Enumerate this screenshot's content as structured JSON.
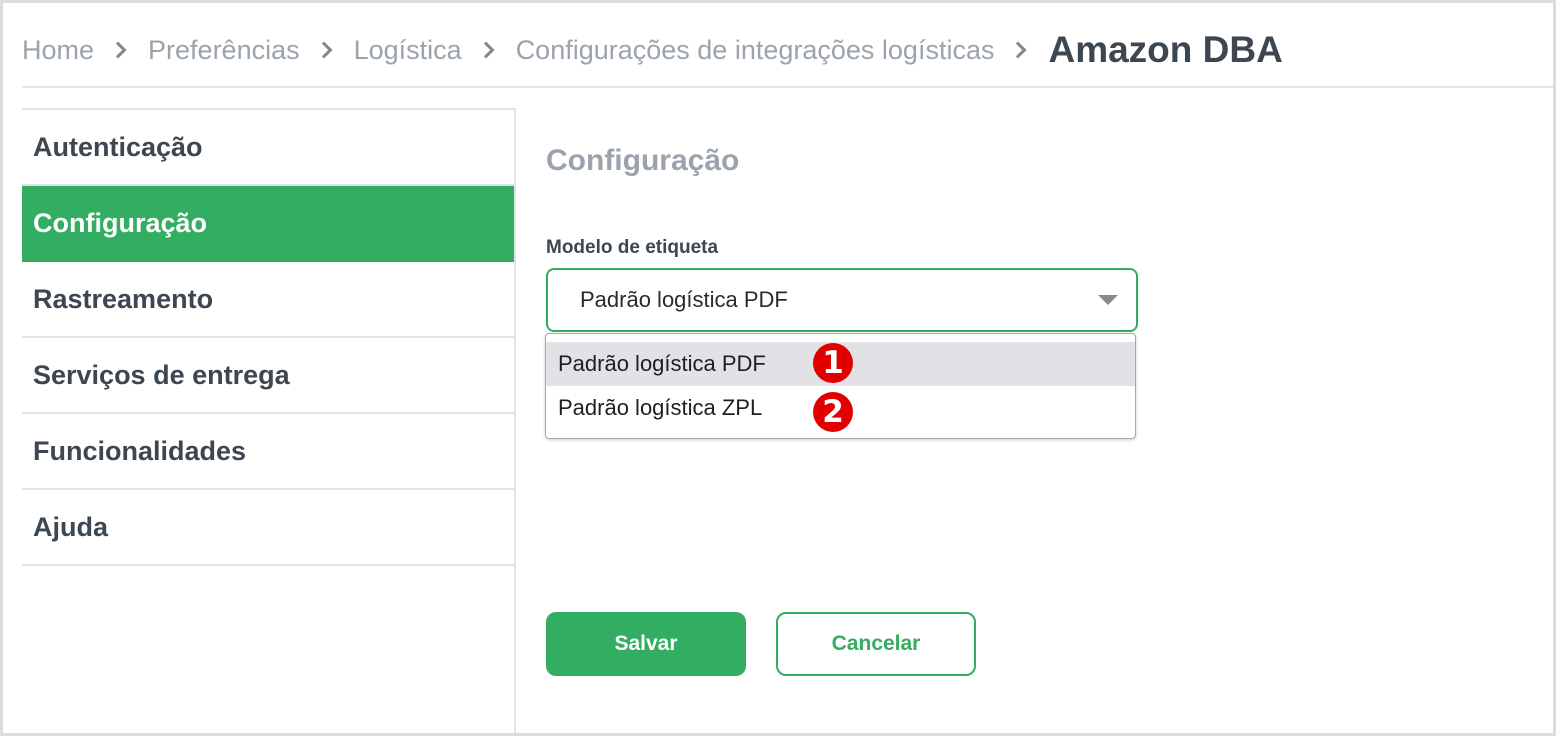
{
  "breadcrumb": {
    "items": [
      "Home",
      "Preferências",
      "Logística",
      "Configurações de integrações logísticas"
    ],
    "current": "Amazon DBA"
  },
  "sidebar": {
    "items": [
      {
        "label": "Autenticação",
        "active": false
      },
      {
        "label": "Configuração",
        "active": true
      },
      {
        "label": "Rastreamento",
        "active": false
      },
      {
        "label": "Serviços de entrega",
        "active": false
      },
      {
        "label": "Funcionalidades",
        "active": false
      },
      {
        "label": "Ajuda",
        "active": false
      }
    ]
  },
  "main": {
    "section_title": "Configuração",
    "field_label": "Modelo de etiqueta",
    "select_value": "Padrão logística PDF",
    "options": [
      "Padrão logística PDF",
      "Padrão logística ZPL"
    ],
    "badges": [
      "1",
      "2"
    ]
  },
  "buttons": {
    "save": "Salvar",
    "cancel": "Cancelar"
  },
  "colors": {
    "accent": "#33ad62",
    "badge": "#e00000",
    "text": "#3d4751",
    "muted": "#9ba3ad"
  },
  "icons": {
    "breadcrumb_separator": "chevron-right-icon",
    "select_caret": "caret-down-icon"
  }
}
